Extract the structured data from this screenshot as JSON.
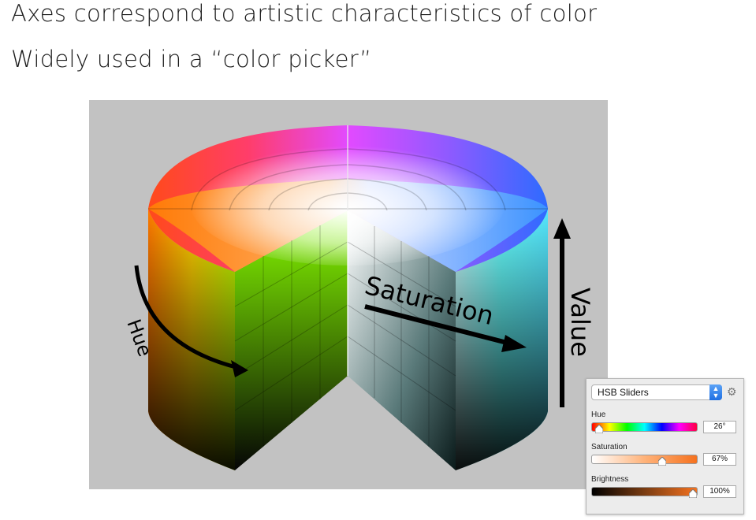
{
  "bullets": [
    "Axes correspond to artistic characteristics of color",
    "Widely used in a “color picker”"
  ],
  "figure": {
    "hue_label": "Hue",
    "saturation_label": "Saturation",
    "value_label": "Value"
  },
  "hsb_panel": {
    "mode_select": "HSB Sliders",
    "gear_icon": "gear-icon",
    "hue": {
      "label": "Hue",
      "value": "26°",
      "fraction": 0.07
    },
    "saturation": {
      "label": "Saturation",
      "value": "67%",
      "fraction": 0.67
    },
    "brightness": {
      "label": "Brightness",
      "value": "100%",
      "fraction": 1.0
    }
  }
}
